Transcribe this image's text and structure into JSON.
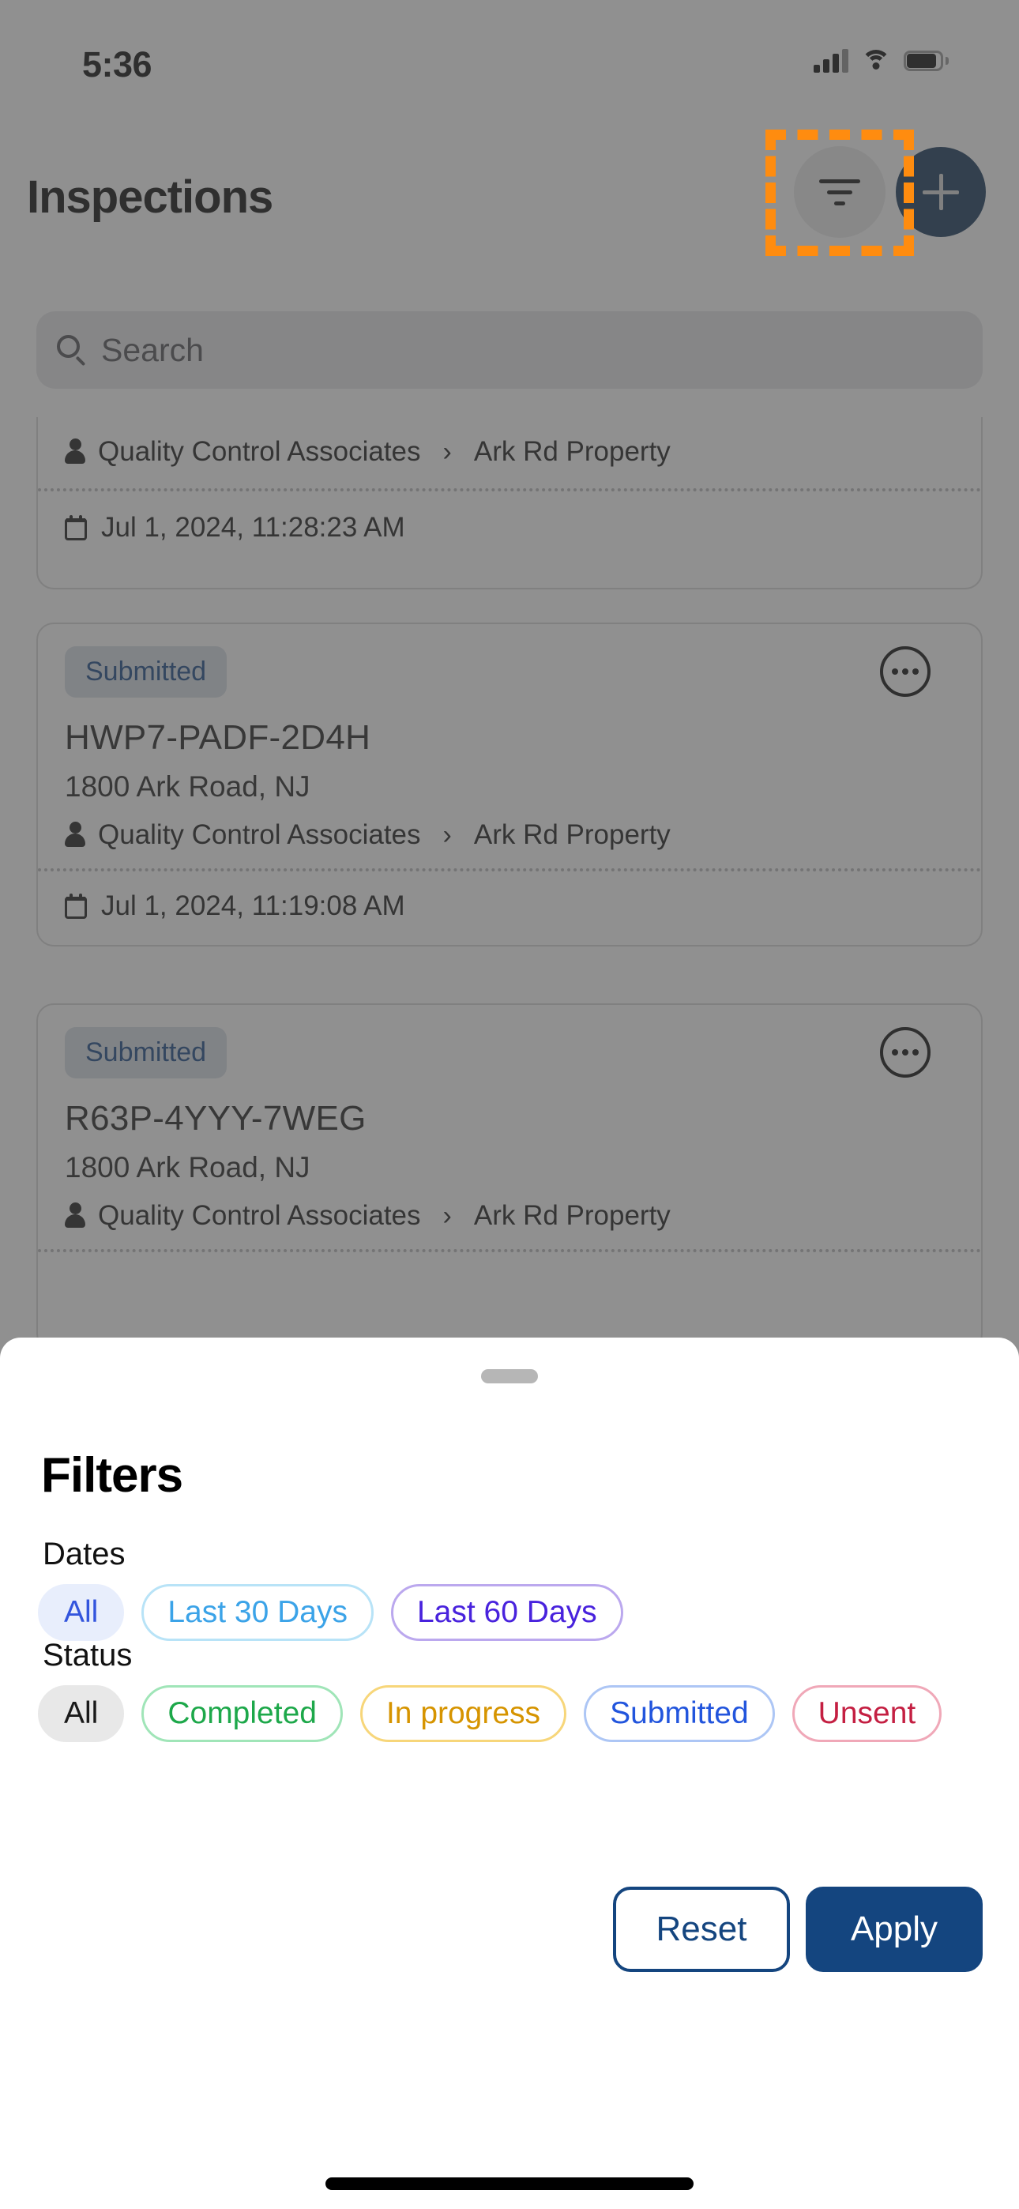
{
  "status_bar": {
    "time": "5:36",
    "icons": [
      "cellular-signal-icon",
      "wifi-icon",
      "battery-icon"
    ]
  },
  "header": {
    "title": "Inspections",
    "filter_button_icon": "filter-icon",
    "add_button_icon": "plus-icon",
    "highlight_color": "#ff8c0f",
    "accent_color": "#0d2f52"
  },
  "search": {
    "placeholder": "Search",
    "value": "",
    "icon": "search-icon"
  },
  "inspections": [
    {
      "status": "",
      "code": "",
      "address": "",
      "company": "Quality Control Associates",
      "property": "Ark Rd Property",
      "date": "Jul 1, 2024, 11:28:23 AM",
      "partial": true
    },
    {
      "status": "Submitted",
      "code": "HWP7-PADF-2D4H",
      "address": "1800 Ark Road, NJ",
      "company": "Quality Control Associates",
      "property": "Ark Rd Property",
      "date": "Jul 1, 2024, 11:19:08 AM",
      "partial": false
    },
    {
      "status": "Submitted",
      "code": "R63P-4YYY-7WEG",
      "address": "1800 Ark Road, NJ",
      "company": "Quality Control Associates",
      "property": "Ark Rd Property",
      "date": "",
      "partial": true
    }
  ],
  "sheet": {
    "title": "Filters",
    "dates": {
      "label": "Dates",
      "options": [
        {
          "label": "All",
          "selected": true,
          "text_color": "#3355dd",
          "bg": "#e8eefc",
          "border": "#e8eefc"
        },
        {
          "label": "Last 30 Days",
          "selected": false,
          "text_color": "#3ba3e8",
          "bg": "#ffffff",
          "border": "#b8e3f7"
        },
        {
          "label": "Last 60 Days",
          "selected": false,
          "text_color": "#4822dd",
          "bg": "#ffffff",
          "border": "#bba8ee"
        }
      ]
    },
    "status": {
      "label": "Status",
      "options": [
        {
          "label": "All",
          "selected": true,
          "text_color": "#1a1a1a",
          "bg": "#e8e8e8",
          "border": "#e8e8e8"
        },
        {
          "label": "Completed",
          "selected": false,
          "text_color": "#1da84a",
          "bg": "#ffffff",
          "border": "#a0e5b8"
        },
        {
          "label": "In progress",
          "selected": false,
          "text_color": "#d69400",
          "bg": "#ffffff",
          "border": "#f7d67a"
        },
        {
          "label": "Submitted",
          "selected": false,
          "text_color": "#2255dd",
          "bg": "#ffffff",
          "border": "#adc6f5"
        },
        {
          "label": "Unsent",
          "selected": false,
          "text_color": "#c41f42",
          "bg": "#ffffff",
          "border": "#f0a8b8"
        }
      ]
    },
    "actions": {
      "reset_label": "Reset",
      "apply_label": "Apply"
    }
  }
}
